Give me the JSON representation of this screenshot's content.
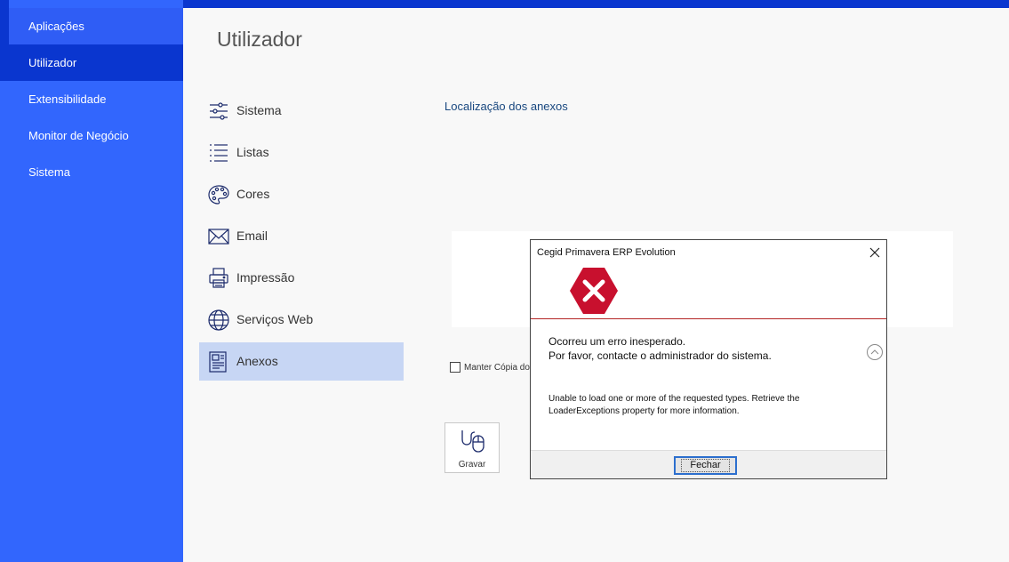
{
  "sidebar": {
    "items": [
      {
        "label": "Aplicações"
      },
      {
        "label": "Utilizador"
      },
      {
        "label": "Extensibilidade"
      },
      {
        "label": "Monitor de Negócio"
      },
      {
        "label": "Sistema"
      }
    ],
    "active_index": 1
  },
  "page": {
    "title": "Utilizador",
    "section_title": "Localização dos anexos",
    "keep_copy_label": "Manter Cópia dos",
    "save_label": "Gravar"
  },
  "menu": {
    "items": [
      {
        "label": "Sistema",
        "icon": "sliders-icon"
      },
      {
        "label": "Listas",
        "icon": "list-icon"
      },
      {
        "label": "Cores",
        "icon": "palette-icon"
      },
      {
        "label": "Email",
        "icon": "envelope-icon"
      },
      {
        "label": "Impressão",
        "icon": "printer-icon"
      },
      {
        "label": "Serviços Web",
        "icon": "globe-icon"
      },
      {
        "label": "Anexos",
        "icon": "attachments-icon"
      }
    ],
    "active_index": 6
  },
  "dialog": {
    "title": "Cegid Primavera ERP Evolution",
    "message_line1": "Ocorreu um erro inesperado.",
    "message_line2": "Por favor, contacte o administrador do sistema.",
    "detail": "Unable to load one or more of the requested types. Retrieve the LoaderExceptions property for more information.",
    "button_label": "Fechar"
  },
  "colors": {
    "sidebar_bg": "#3266fd",
    "sidebar_active": "#0a36cf",
    "menu_active": "#c7d6f4",
    "error_red": "#c8102e",
    "icon_stroke": "#1b2a6b"
  }
}
